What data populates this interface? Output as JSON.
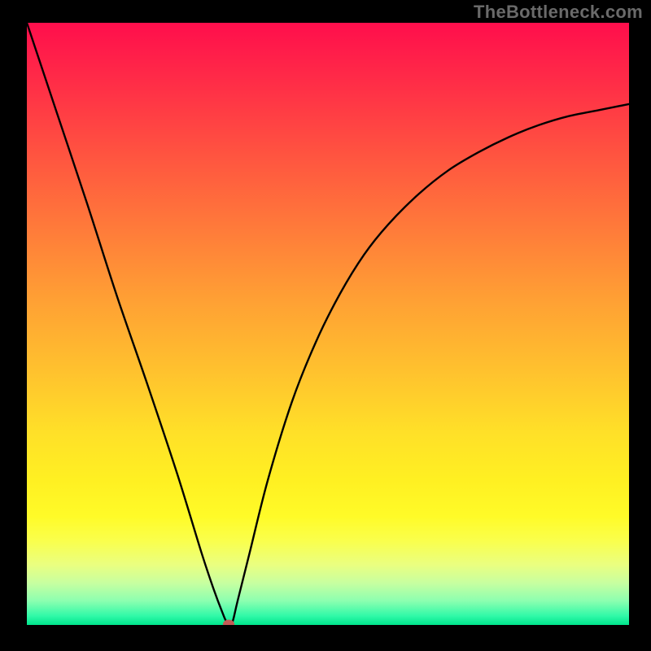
{
  "watermark": "TheBottleneck.com",
  "chart_data": {
    "type": "line",
    "title": "",
    "xlabel": "",
    "ylabel": "",
    "xlim": [
      0,
      1
    ],
    "ylim": [
      0,
      1
    ],
    "grid": false,
    "gradient_stops": [
      {
        "pos": 0.0,
        "color": "#ff0e4c"
      },
      {
        "pos": 0.1,
        "color": "#ff2d47"
      },
      {
        "pos": 0.22,
        "color": "#ff5440"
      },
      {
        "pos": 0.34,
        "color": "#ff7a3a"
      },
      {
        "pos": 0.46,
        "color": "#ffa034"
      },
      {
        "pos": 0.58,
        "color": "#ffc22e"
      },
      {
        "pos": 0.68,
        "color": "#ffe028"
      },
      {
        "pos": 0.76,
        "color": "#fff022"
      },
      {
        "pos": 0.82,
        "color": "#fffb28"
      },
      {
        "pos": 0.86,
        "color": "#faff4c"
      },
      {
        "pos": 0.9,
        "color": "#eaff80"
      },
      {
        "pos": 0.93,
        "color": "#c8ffa0"
      },
      {
        "pos": 0.96,
        "color": "#8cffb0"
      },
      {
        "pos": 0.985,
        "color": "#30f9a8"
      },
      {
        "pos": 1.0,
        "color": "#00e58c"
      }
    ],
    "series": [
      {
        "name": "bottleneck-curve",
        "x": [
          0.0,
          0.05,
          0.1,
          0.15,
          0.2,
          0.25,
          0.29,
          0.31,
          0.325,
          0.332,
          0.34,
          0.343,
          0.35,
          0.37,
          0.4,
          0.44,
          0.48,
          0.52,
          0.56,
          0.6,
          0.65,
          0.7,
          0.75,
          0.8,
          0.85,
          0.9,
          0.95,
          1.0
        ],
        "y": [
          1.0,
          0.85,
          0.7,
          0.545,
          0.4,
          0.25,
          0.12,
          0.06,
          0.02,
          0.005,
          0.005,
          0.01,
          0.04,
          0.12,
          0.24,
          0.37,
          0.47,
          0.55,
          0.615,
          0.665,
          0.715,
          0.755,
          0.785,
          0.81,
          0.83,
          0.845,
          0.855,
          0.865
        ]
      }
    ],
    "marker": {
      "x": 0.335,
      "y": 0.002,
      "color": "#c45a56"
    }
  }
}
